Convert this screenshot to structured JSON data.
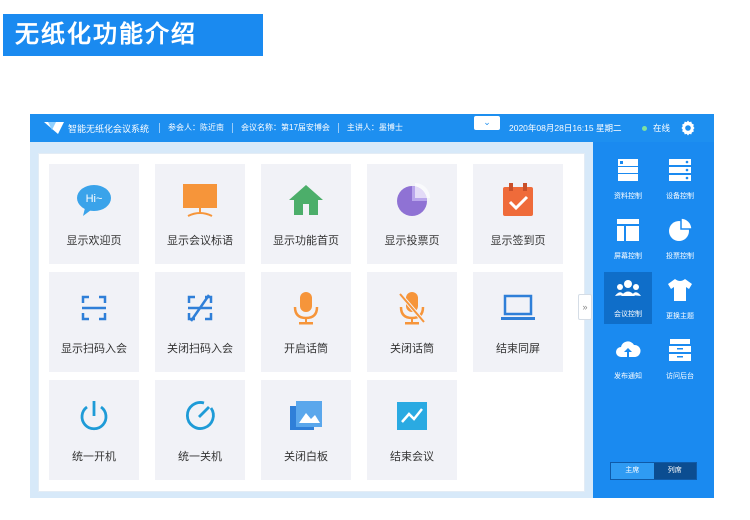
{
  "banner": {
    "title": "无纸化功能介绍"
  },
  "topbar": {
    "app_title": "智能无纸化会议系统",
    "participant": "参会人：陈近南",
    "meeting_name": "会议名称：第17届安博会",
    "host": "主讲人：墨博士",
    "collapse_glyph": "⌄",
    "datetime": "2020年08月28日16:15 星期二",
    "status": "在线",
    "colors": {
      "bar": "#1d8ff0",
      "status_dot": "#7fe0a0"
    }
  },
  "tiles": [
    {
      "label": "显示欢迎页",
      "icon": "hi-bubble-icon"
    },
    {
      "label": "显示会议标语",
      "icon": "monitor-icon"
    },
    {
      "label": "显示功能首页",
      "icon": "home-icon"
    },
    {
      "label": "显示投票页",
      "icon": "pie-chart-icon"
    },
    {
      "label": "显示签到页",
      "icon": "calendar-check-icon"
    },
    {
      "label": "显示扫码入会",
      "icon": "scan-icon"
    },
    {
      "label": "关闭扫码入会",
      "icon": "scan-off-icon"
    },
    {
      "label": "开启话筒",
      "icon": "microphone-icon"
    },
    {
      "label": "关闭话筒",
      "icon": "microphone-off-icon"
    },
    {
      "label": "结束同屏",
      "icon": "laptop-icon"
    },
    {
      "label": "统一开机",
      "icon": "power-icon"
    },
    {
      "label": "统一关机",
      "icon": "gauge-off-icon"
    },
    {
      "label": "关闭白板",
      "icon": "gallery-icon"
    },
    {
      "label": "结束会议",
      "icon": "trend-chart-icon"
    }
  ],
  "expand_glyph": "»",
  "sidebar": {
    "items": [
      {
        "label": "资料控制",
        "icon": "documents-icon"
      },
      {
        "label": "设备控制",
        "icon": "server-icon"
      },
      {
        "label": "屏幕控制",
        "icon": "layout-icon"
      },
      {
        "label": "投票控制",
        "icon": "pie-icon"
      },
      {
        "label": "会议控制",
        "icon": "people-icon",
        "active": true
      },
      {
        "label": "更换主题",
        "icon": "tshirt-icon"
      },
      {
        "label": "发布通知",
        "icon": "cloud-upload-icon"
      },
      {
        "label": "访问后台",
        "icon": "archive-icon"
      }
    ],
    "segments": [
      "主席",
      "列席"
    ],
    "selected_segment": "主席"
  }
}
